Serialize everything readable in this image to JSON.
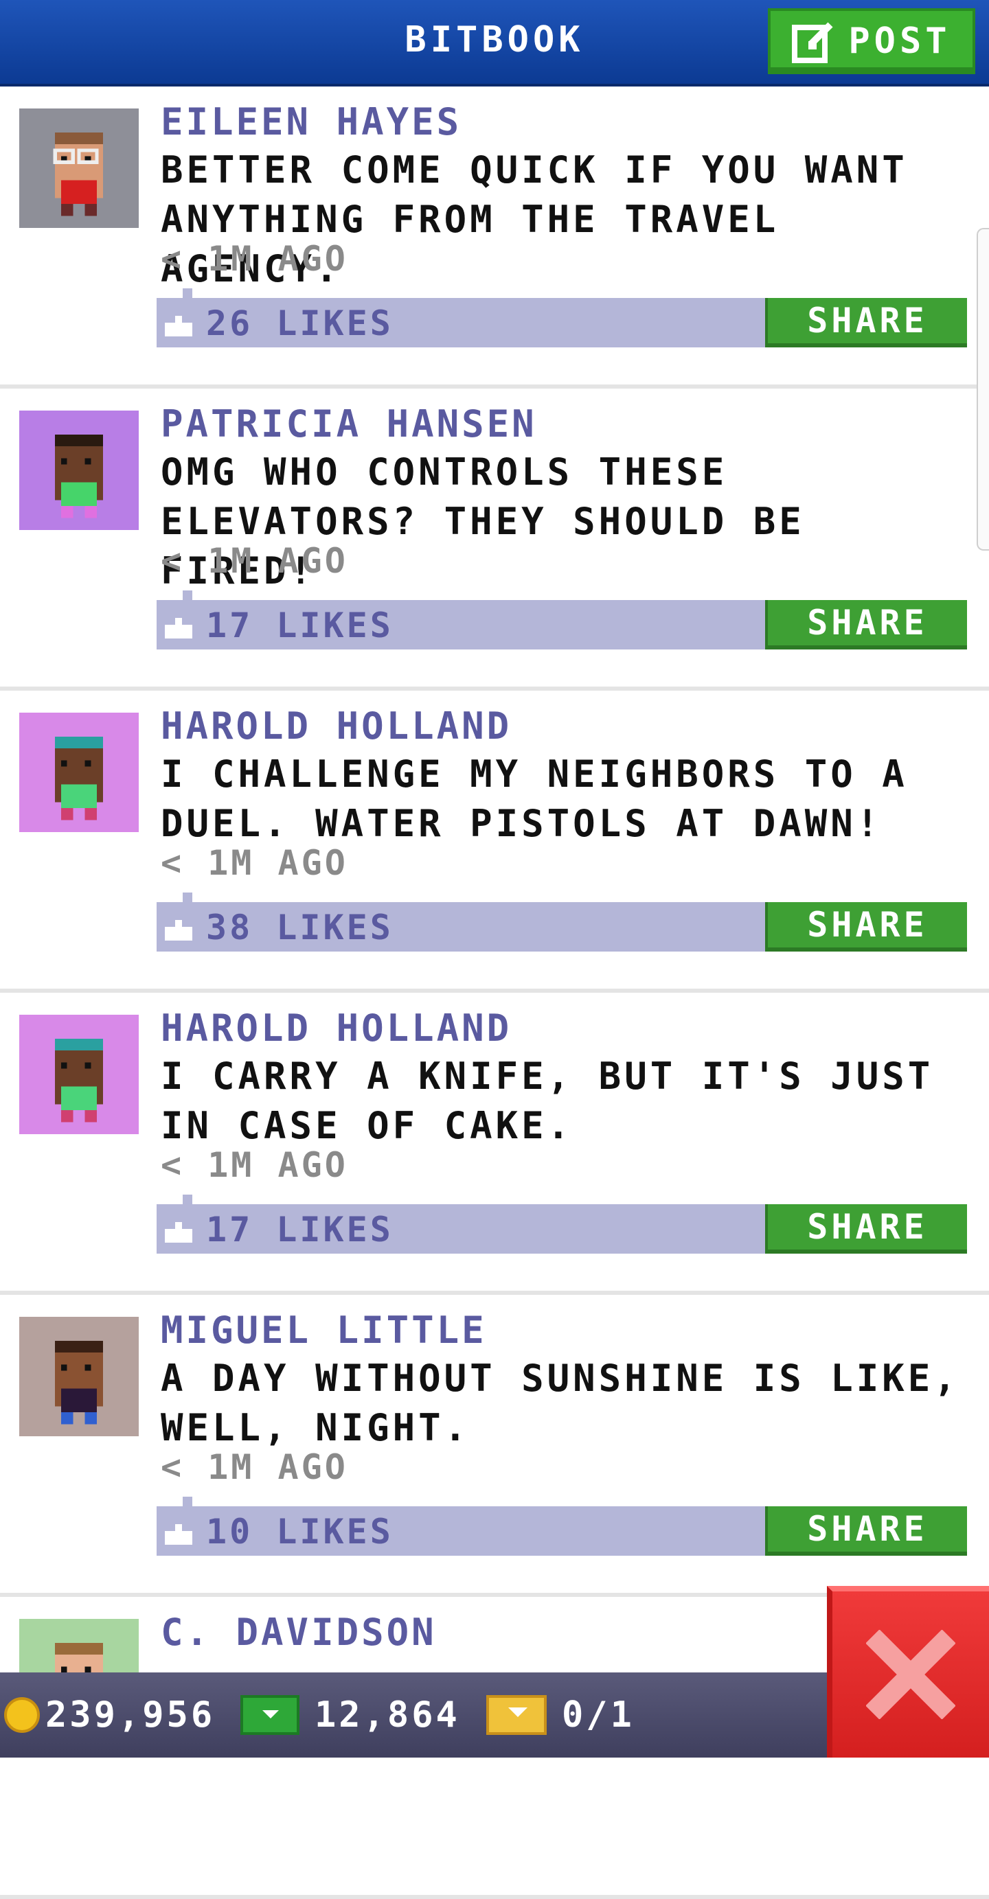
{
  "header": {
    "title": "BITBOOK",
    "post_label": "POST"
  },
  "posts": [
    {
      "author": "EILEEN HAYES",
      "message": "BETTER COME QUICK IF YOU WANT ANYTHING FROM THE TRAVEL AGENCY.",
      "time": "< 1M AGO",
      "likes": "26 LIKES",
      "share_label": "SHARE",
      "avatar": {
        "bg": "#8e8f98",
        "skin": "#d99a76",
        "hair": "#8a5a3a",
        "shirt": "#d62020",
        "pants": "#6a2a2a",
        "glasses": true
      }
    },
    {
      "author": "PATRICIA HANSEN",
      "message": "OMG WHO CONTROLS THESE ELEVATORS? THEY SHOULD BE FIRED!",
      "time": "< 1M AGO",
      "likes": "17 LIKES",
      "share_label": "SHARE",
      "avatar": {
        "bg": "#b87ee6",
        "skin": "#6b3f28",
        "hair": "#2a1a10",
        "shirt": "#46d46a",
        "pants": "#e070e0",
        "glasses": false
      }
    },
    {
      "author": "HAROLD HOLLAND",
      "message": "I CHALLENGE MY NEIGHBORS TO A DUEL. WATER PISTOLS AT DAWN!",
      "time": "< 1M AGO",
      "likes": "38 LIKES",
      "share_label": "SHARE",
      "avatar": {
        "bg": "#d889e8",
        "skin": "#6b3f28",
        "hair": "#2aa0a0",
        "shirt": "#4ad47a",
        "pants": "#d04070",
        "glasses": false
      }
    },
    {
      "author": "HAROLD HOLLAND",
      "message": "I CARRY A KNIFE, BUT IT'S JUST IN CASE OF CAKE.",
      "time": "< 1M AGO",
      "likes": "17 LIKES",
      "share_label": "SHARE",
      "avatar": {
        "bg": "#d889e8",
        "skin": "#6b3f28",
        "hair": "#2aa0a0",
        "shirt": "#4ad47a",
        "pants": "#d04070",
        "glasses": false
      }
    },
    {
      "author": "MIGUEL LITTLE",
      "message": "A DAY WITHOUT SUNSHINE IS LIKE, WELL, NIGHT.",
      "time": "< 1M AGO",
      "likes": "10 LIKES",
      "share_label": "SHARE",
      "avatar": {
        "bg": "#b5a19d",
        "skin": "#8a5232",
        "hair": "#3a2014",
        "shirt": "#2a1838",
        "pants": "#3060d0",
        "glasses": false
      }
    },
    {
      "author": "C. DAVIDSON",
      "message": "",
      "time": "",
      "likes": "",
      "share_label": "",
      "avatar": {
        "bg": "#a8d6a0",
        "skin": "#e8b090",
        "hair": "#9a6a3a",
        "shirt": "#ffffff",
        "pants": "#ffffff",
        "glasses": false
      }
    }
  ],
  "bottom_bar": {
    "coins": "239,956",
    "bux": "12,864",
    "tickets": "0/1"
  },
  "icons": {
    "post": "edit-icon",
    "like": "thumb-up-icon",
    "coin": "coin-icon",
    "bux": "cash-icon",
    "ticket": "ticket-icon",
    "close": "close-icon"
  }
}
